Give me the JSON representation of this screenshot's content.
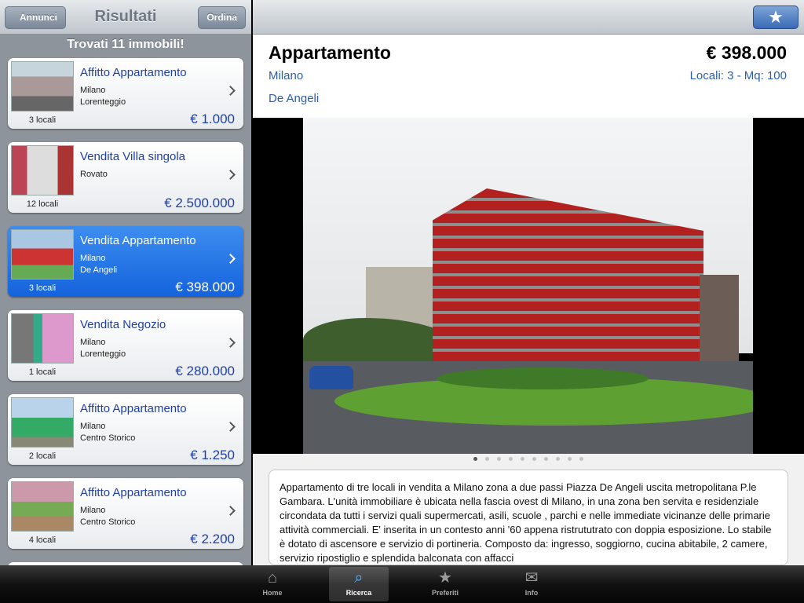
{
  "left_nav": {
    "back_label": "Annunci",
    "title": "Risultati",
    "sort_label": "Ordina"
  },
  "results": {
    "summary": "Trovati 11 immobili!",
    "items": [
      {
        "title": "Affitto Appartamento",
        "city": "Milano",
        "zone": "Lorenteggio",
        "rooms": "3 locali",
        "price": "€ 1.000"
      },
      {
        "title": "Vendita Villa singola",
        "city": "Rovato",
        "zone": "",
        "rooms": "12 locali",
        "price": "€ 2.500.000"
      },
      {
        "title": "Vendita Appartamento",
        "city": "Milano",
        "zone": "De Angeli",
        "rooms": "3 locali",
        "price": "€ 398.000"
      },
      {
        "title": "Vendita Negozio",
        "city": "Milano",
        "zone": "Lorenteggio",
        "rooms": "1 locali",
        "price": "€ 280.000"
      },
      {
        "title": "Affitto Appartamento",
        "city": "Milano",
        "zone": "Centro Storico",
        "rooms": "2 locali",
        "price": "€ 1.250"
      },
      {
        "title": "Affitto Appartamento",
        "city": "Milano",
        "zone": "Centro Storico",
        "rooms": "4 locali",
        "price": "€ 2.200"
      }
    ],
    "selected_index": 2
  },
  "detail": {
    "favorite_icon": "star-icon",
    "title": "Appartamento",
    "price": "€ 398.000",
    "city": "Milano",
    "zone": "De Angeli",
    "stats": "Locali: 3 -  Mq: 100",
    "photo_count": 10,
    "photo_index": 1,
    "description": "Appartamento di tre  locali in vendita a Milano zona a due passi Piazza De Angeli uscita metropolitana P.le Gambara.    L'unità immobiliare è ubicata nella fascia ovest di Milano, in una  zona ben servita e residenziale  circondata da tutti i servizi quali supermercati, asili, scuole , parchi e nelle immediate vicinanze delle primarie attività commerciali.    E' inserita in un contesto anni '60 appena ristrututrato con doppia  esposizione.     Lo stabile è dotato di  ascensore e servizio di portineria.    Composto da: ingresso, soggiorno, cucina abitabile,  2 camere,  servizio ripostiglio e splendida balconata con affacci"
  },
  "tabs": [
    {
      "label": "Home",
      "icon": "home-icon",
      "glyph": "⌂"
    },
    {
      "label": "Ricerca",
      "icon": "search-icon",
      "glyph": "⌕"
    },
    {
      "label": "Preferiti",
      "icon": "star-icon",
      "glyph": "★"
    },
    {
      "label": "Info",
      "icon": "envelope-icon",
      "glyph": "✉"
    }
  ],
  "active_tab": 1,
  "colors": {
    "selected_row": "#1463dd",
    "link_blue": "#2d5ea8",
    "title_blue": "#1f3fa8",
    "tab_active": "#5ab1ff"
  }
}
